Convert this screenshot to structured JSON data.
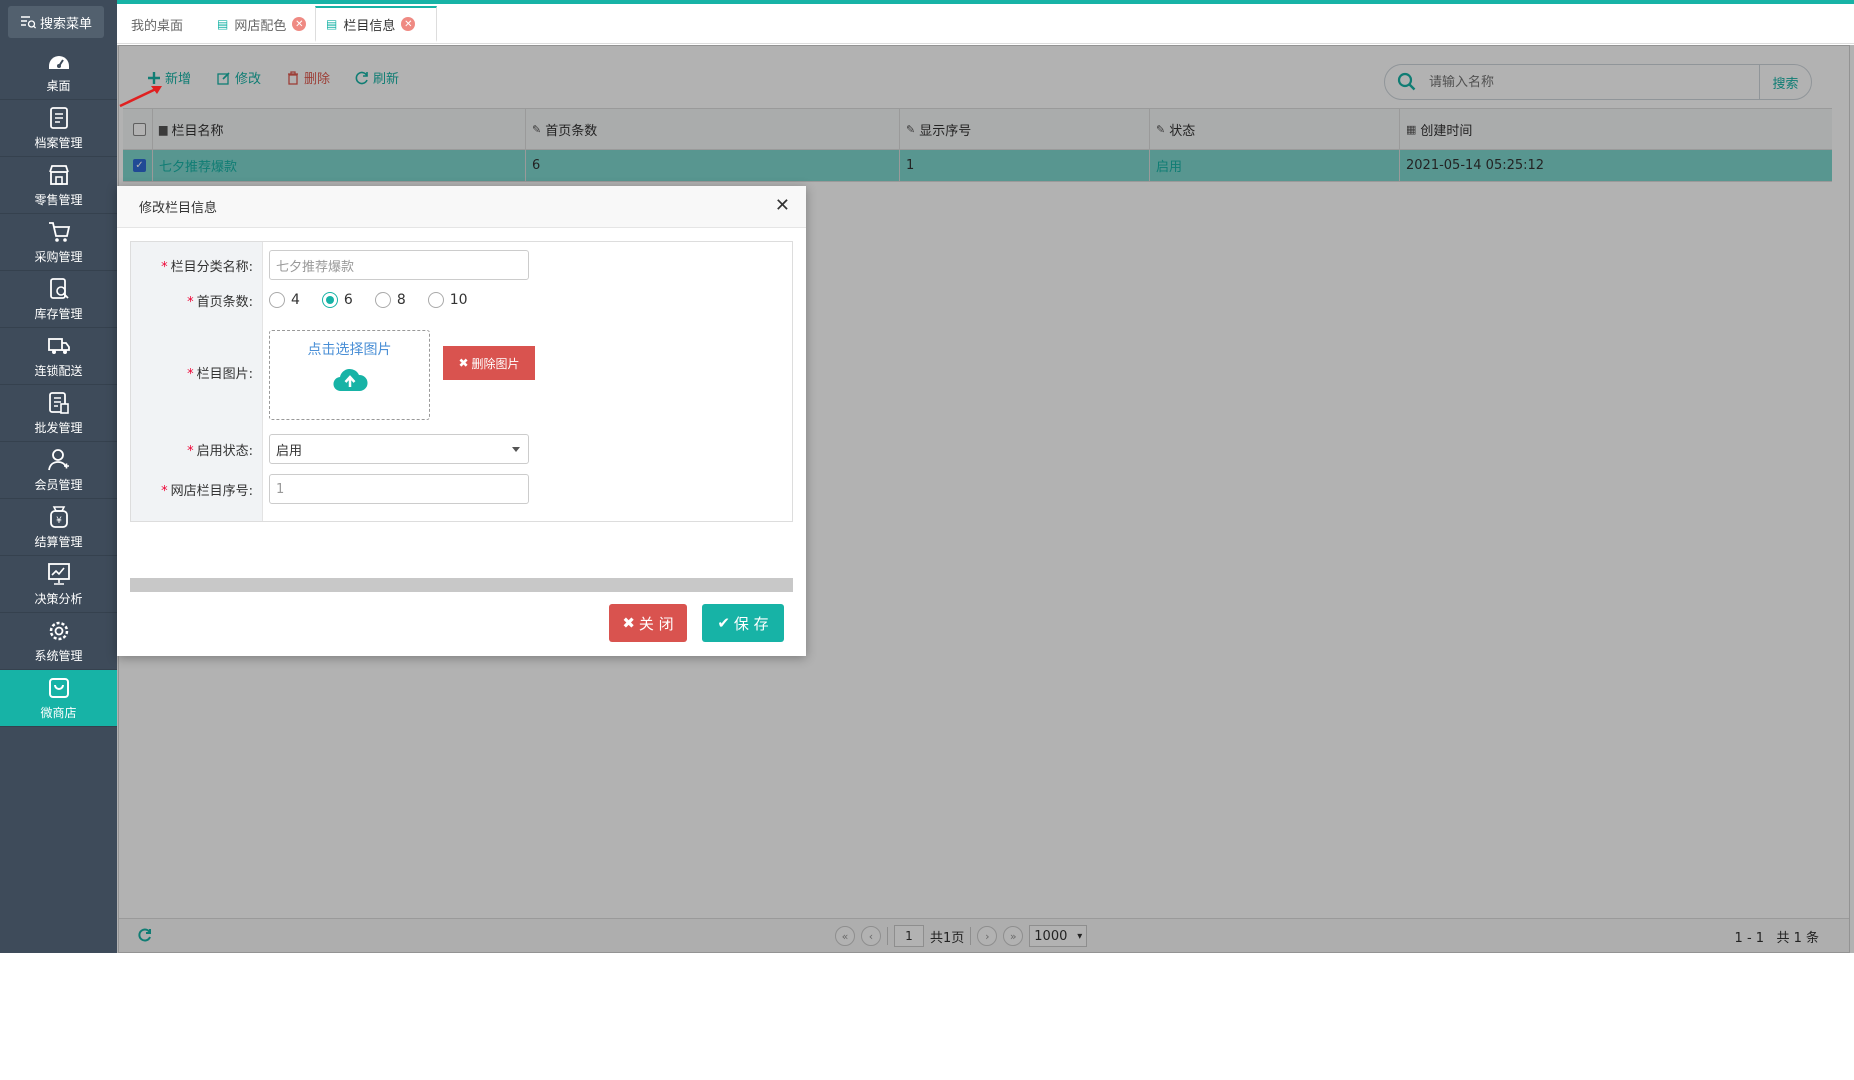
{
  "sidebar": {
    "search_menu": "搜索菜单",
    "items": [
      {
        "label": "桌面",
        "icon": "dashboard-icon"
      },
      {
        "label": "档案管理",
        "icon": "archive-icon"
      },
      {
        "label": "零售管理",
        "icon": "store-icon"
      },
      {
        "label": "采购管理",
        "icon": "cart-icon"
      },
      {
        "label": "库存管理",
        "icon": "inventory-icon"
      },
      {
        "label": "连锁配送",
        "icon": "truck-icon"
      },
      {
        "label": "批发管理",
        "icon": "wholesale-icon"
      },
      {
        "label": "会员管理",
        "icon": "member-icon"
      },
      {
        "label": "结算管理",
        "icon": "settlement-icon"
      },
      {
        "label": "决策分析",
        "icon": "chart-icon"
      },
      {
        "label": "系统管理",
        "icon": "gear-icon"
      },
      {
        "label": "微商店",
        "icon": "shop-bag-icon"
      }
    ],
    "active_index": 11
  },
  "tabs": [
    {
      "label": "我的桌面",
      "closable": false
    },
    {
      "label": "网店配色",
      "closable": true
    },
    {
      "label": "栏目信息",
      "closable": true,
      "active": true
    }
  ],
  "toolbar": {
    "add": "新增",
    "edit": "修改",
    "delete": "删除",
    "refresh": "刷新",
    "search_placeholder": "请输入名称",
    "search_button": "搜索"
  },
  "grid": {
    "columns": [
      "栏目名称",
      "首页条数",
      "显示序号",
      "状态",
      "创建时间"
    ],
    "rows": [
      {
        "name": "七夕推荐爆款",
        "count": "6",
        "order": "1",
        "status": "启用",
        "created": "2021-05-14 05:25:12",
        "checked": true
      }
    ]
  },
  "pager": {
    "page": "1",
    "total_pages": "共1页",
    "page_size": "1000",
    "range": "1 - 1",
    "total_records": "共 1 条"
  },
  "dialog": {
    "title": "修改栏目信息",
    "fields": {
      "name_label": "栏目分类名称:",
      "name_placeholder": "七夕推荐爆款",
      "count_label": "首页条数:",
      "count_options": [
        "4",
        "6",
        "8",
        "10"
      ],
      "count_selected": "6",
      "image_label": "栏目图片:",
      "upload_text": "点击选择图片",
      "delete_image": "删除图片",
      "status_label": "启用状态:",
      "status_value": "启用",
      "order_label": "网店栏目序号:",
      "order_value": "1"
    },
    "close_button": "关 闭",
    "save_button": "保 存"
  },
  "colors": {
    "accent": "#17b3a6",
    "sidebar_bg": "#3e4b5a",
    "danger": "#d9534f"
  }
}
